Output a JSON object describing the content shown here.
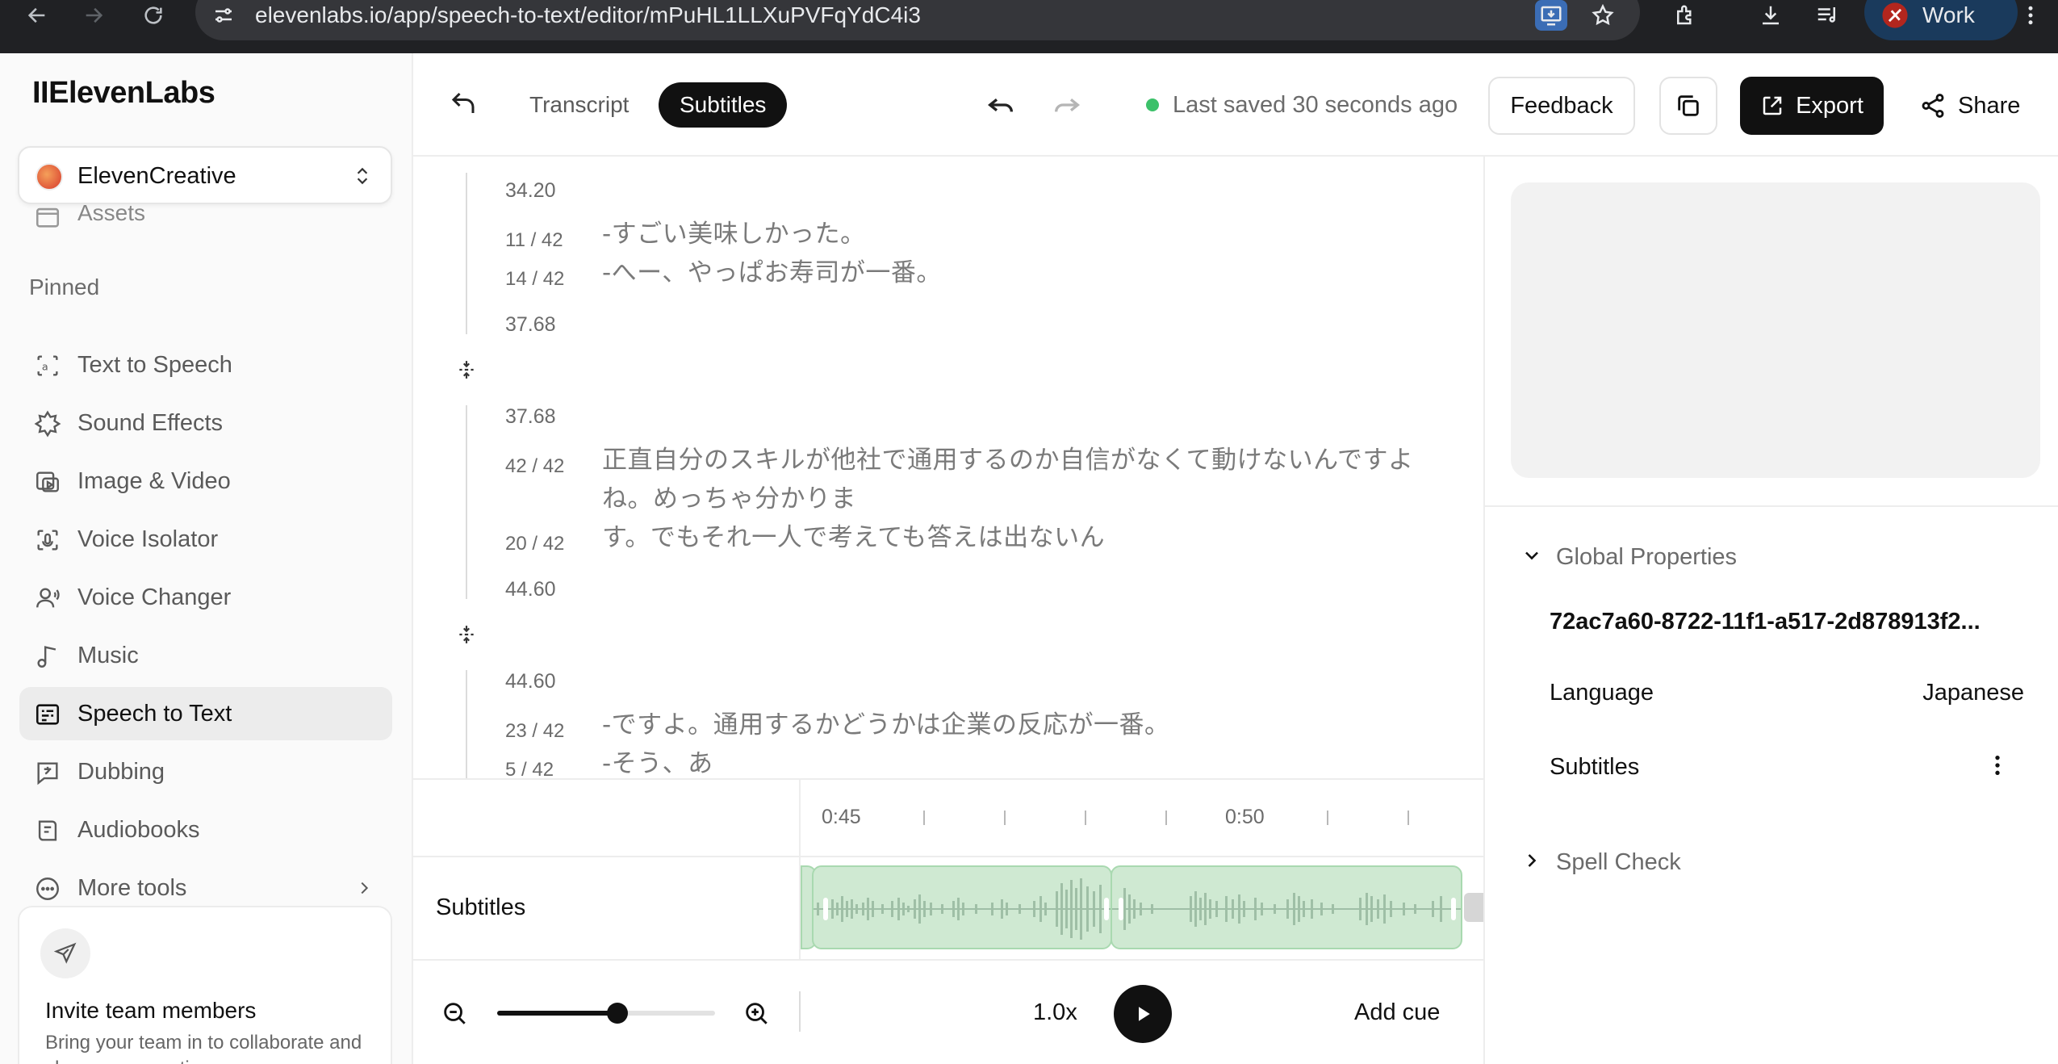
{
  "browser": {
    "url": "elevenlabs.io/app/speech-to-text/editor/mPuHL1LLXuPVFqYdC4i3",
    "profile": "Work"
  },
  "sidebar": {
    "logo": "IIElevenLabs",
    "workspace": "ElevenCreative",
    "assets": "Assets",
    "pinned_label": "Pinned",
    "items": [
      {
        "label": "Text to Speech",
        "icon": "text-to-speech-icon"
      },
      {
        "label": "Sound Effects",
        "icon": "sound-effects-icon"
      },
      {
        "label": "Image & Video",
        "icon": "image-video-icon"
      },
      {
        "label": "Voice Isolator",
        "icon": "voice-isolator-icon"
      },
      {
        "label": "Voice Changer",
        "icon": "voice-changer-icon"
      },
      {
        "label": "Music",
        "icon": "music-icon"
      },
      {
        "label": "Speech to Text",
        "icon": "speech-to-text-icon",
        "active": true
      },
      {
        "label": "Dubbing",
        "icon": "dubbing-icon"
      },
      {
        "label": "Audiobooks",
        "icon": "audiobooks-icon"
      },
      {
        "label": "More tools",
        "icon": "more-tools-icon"
      }
    ],
    "invite": {
      "title": "Invite team members",
      "desc": "Bring your team in to collaborate and share your creations."
    }
  },
  "topbar": {
    "tabs": [
      "Transcript",
      "Subtitles"
    ],
    "active_tab": "Subtitles",
    "saved_status": "Last saved 30 seconds ago",
    "feedback": "Feedback",
    "export": "Export",
    "share": "Share"
  },
  "cues": [
    {
      "start": "34.20",
      "end": "37.68",
      "lines": [
        {
          "count": "11 / 42",
          "text": "-すごい美味しかった。"
        },
        {
          "count": "14 / 42",
          "text": "-へー、やっぱお寿司が一番。"
        }
      ]
    },
    {
      "start": "37.68",
      "end": "44.60",
      "lines": [
        {
          "count": "42 / 42",
          "text": "正直自分のスキルが他社で通用するのか自信がなくて動けないんですよ",
          "text2": "ね。めっちゃ分かりま"
        },
        {
          "count": "20 / 42",
          "text": "す。でもそれ一人で考えても答えは出ないん"
        }
      ]
    },
    {
      "start": "44.60",
      "lines": [
        {
          "count": "23 / 42",
          "text": "-ですよ。通用するかどうかは企業の反応が一番。"
        },
        {
          "count": "5 / 42",
          "text": "-そう、あ"
        }
      ]
    }
  ],
  "timeline": {
    "ruler_labels": [
      "0:45",
      "0:50"
    ],
    "track_label": "Subtitles"
  },
  "controls": {
    "zoom_level": 0.55,
    "speed": "1.0x",
    "add_cue": "Add cue"
  },
  "right_panel": {
    "global_properties": "Global Properties",
    "file_id": "72ac7a60-8722-11f1-a517-2d878913f2...",
    "language_label": "Language",
    "language_value": "Japanese",
    "subtitles_label": "Subtitles",
    "spell_check": "Spell Check"
  },
  "colors": {
    "accent": "#111111",
    "saved_dot": "#3cc16a",
    "waveform_fill": "#cfe9d2",
    "sidebar_bg": "#fafafa"
  }
}
